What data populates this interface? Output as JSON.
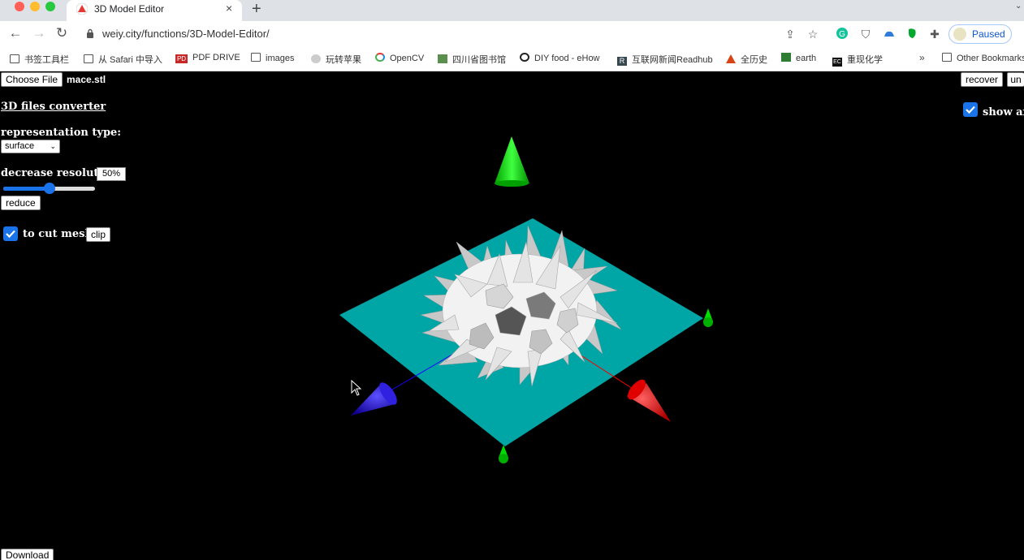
{
  "browser": {
    "tab_title": "3D Model Editor",
    "tab_close": "×",
    "new_tab": "+",
    "url": "weiy.city/functions/3D-Model-Editor/",
    "profile_label": "Paused",
    "bookmarks": [
      {
        "label": "书签工具栏",
        "icon": "folder-icon"
      },
      {
        "label": "从 Safari 中导入",
        "icon": "folder-icon"
      },
      {
        "label": "PDF DRIVE",
        "icon": "pdf-drive-icon"
      },
      {
        "label": "images",
        "icon": "folder-icon"
      },
      {
        "label": "玩转苹果",
        "icon": "apple-icon"
      },
      {
        "label": "OpenCV",
        "icon": "opencv-icon"
      },
      {
        "label": "四川省图书馆",
        "icon": "library-icon"
      },
      {
        "label": "DIY food - eHow",
        "icon": "ehow-icon"
      },
      {
        "label": "互联网新闻Readhub",
        "icon": "readhub-icon"
      },
      {
        "label": "全历史",
        "icon": "history-icon"
      },
      {
        "label": "earth",
        "icon": "earth-icon"
      },
      {
        "label": "重现化学",
        "icon": "chemistry-icon"
      }
    ],
    "more_bookmarks": "»",
    "other_bookmarks": "Other Bookmarks"
  },
  "editor": {
    "choose_file": "Choose File",
    "file_name": "mace.stl",
    "converter_link": "3D files converter",
    "representation_label": "representation type:",
    "representation_value": "surface",
    "decrease_resolution_label": "decrease resolution:",
    "resolution_value": "50%",
    "resolution_fraction": 0.5,
    "reduce_button": "reduce",
    "cut_mesh_label": "to cut mesh",
    "cut_mesh_checked": true,
    "clip_button": "clip",
    "recover_button": "recover",
    "undo_button": "un",
    "show_axes_label": "show axes",
    "show_axes_checked": true,
    "download_button": "Download"
  },
  "colors": {
    "plane": "#00a5a5",
    "axis_x": "#ff0000",
    "axis_y": "#00dd00",
    "axis_z": "#1a00ff",
    "accent": "#1a73e8"
  }
}
